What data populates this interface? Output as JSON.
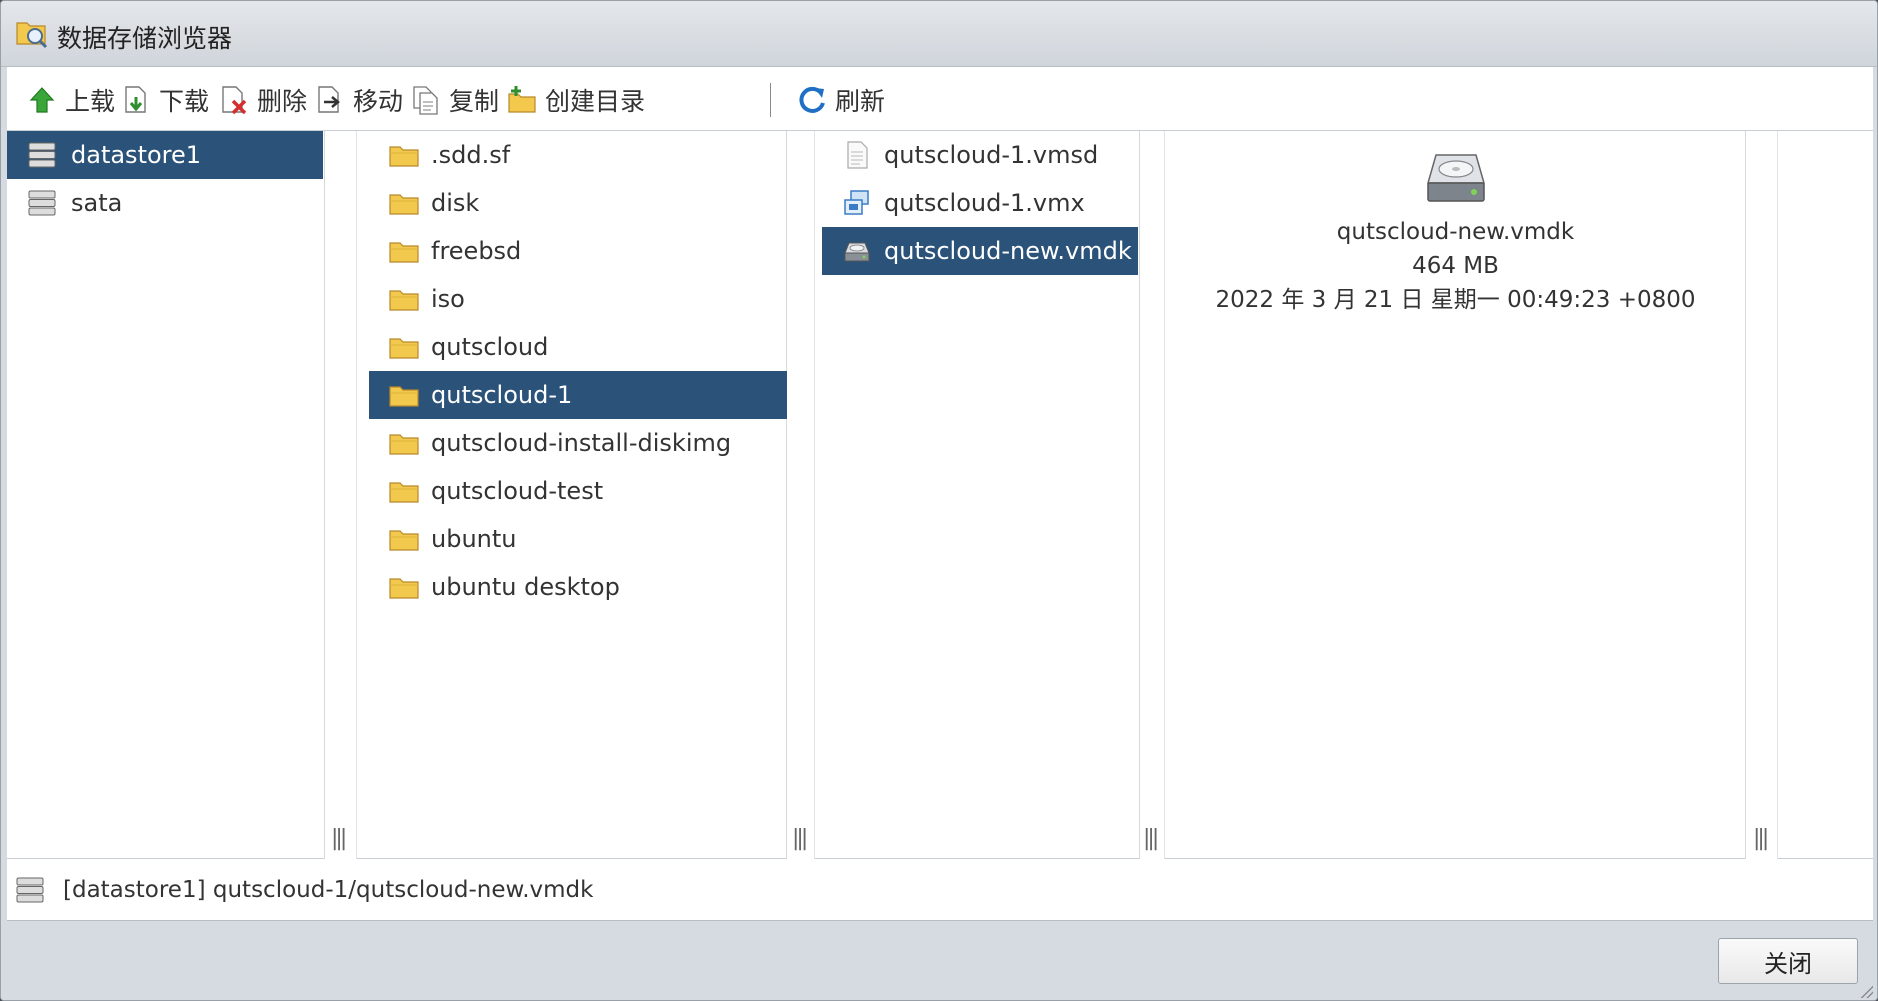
{
  "window": {
    "title": "数据存储浏览器"
  },
  "toolbar": {
    "upload": "上载",
    "download": "下载",
    "delete": "删除",
    "move": "移动",
    "copy": "复制",
    "mkdir": "创建目录",
    "refresh": "刷新"
  },
  "datastores": [
    {
      "name": "datastore1",
      "selected": true
    },
    {
      "name": "sata",
      "selected": false
    }
  ],
  "folders": [
    {
      "name": ".sdd.sf",
      "selected": false
    },
    {
      "name": "disk",
      "selected": false
    },
    {
      "name": "freebsd",
      "selected": false
    },
    {
      "name": "iso",
      "selected": false
    },
    {
      "name": "qutscloud",
      "selected": false
    },
    {
      "name": "qutscloud-1",
      "selected": true
    },
    {
      "name": "qutscloud-install-diskimg",
      "selected": false
    },
    {
      "name": "qutscloud-test",
      "selected": false
    },
    {
      "name": "ubuntu",
      "selected": false
    },
    {
      "name": "ubuntu desktop",
      "selected": false
    }
  ],
  "files": [
    {
      "name": "qutscloud-1.vmsd",
      "icon": "document-icon",
      "selected": false
    },
    {
      "name": "qutscloud-1.vmx",
      "icon": "vm-config-icon",
      "selected": false
    },
    {
      "name": "qutscloud-new.vmdk",
      "icon": "disk-icon",
      "selected": true
    }
  ],
  "details": {
    "name": "qutscloud-new.vmdk",
    "size": "464 MB",
    "modified": "2022 年 3 月 21 日 星期一 00:49:23 +0800"
  },
  "path": "[datastore1] qutscloud-1/qutscloud-new.vmdk",
  "footer": {
    "close": "关闭"
  },
  "colors": {
    "selection": "#2b5279",
    "folder": "#f2c94c"
  }
}
